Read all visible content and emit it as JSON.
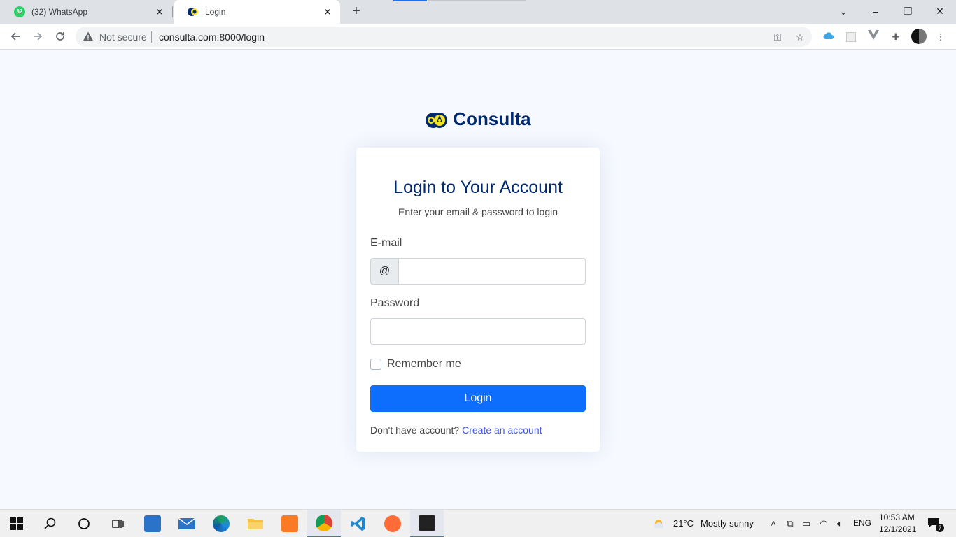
{
  "browser": {
    "tabs": [
      {
        "title": "(32) WhatsApp",
        "badge": "32",
        "active": false
      },
      {
        "title": "Login",
        "active": true
      }
    ],
    "close_glyph": "✕",
    "new_tab_glyph": "+",
    "security_text": "Not secure",
    "url": "consulta.com:8000/login",
    "window_controls": [
      "⌄",
      "–",
      "❐",
      "✕"
    ]
  },
  "page": {
    "brand_name": "Consulta",
    "title": "Login to Your Account",
    "subtitle": "Enter your email & password to login",
    "email_label": "E-mail",
    "email_addon": "@",
    "email_value": "",
    "password_label": "Password",
    "password_value": "",
    "remember_label": "Remember me",
    "remember_checked": false,
    "login_label": "Login",
    "signup_prompt": "Don't have account?",
    "signup_link": "Create an account"
  },
  "taskbar": {
    "weather_temp": "21°C",
    "weather_text": "Mostly sunny",
    "language": "ENG",
    "time": "10:53 AM",
    "date": "12/1/2021",
    "notification_count": "7"
  },
  "colors": {
    "brand": "#012970",
    "primary_button": "#0d6efd",
    "link": "#4154f1",
    "page_bg": "#f6f9ff"
  }
}
